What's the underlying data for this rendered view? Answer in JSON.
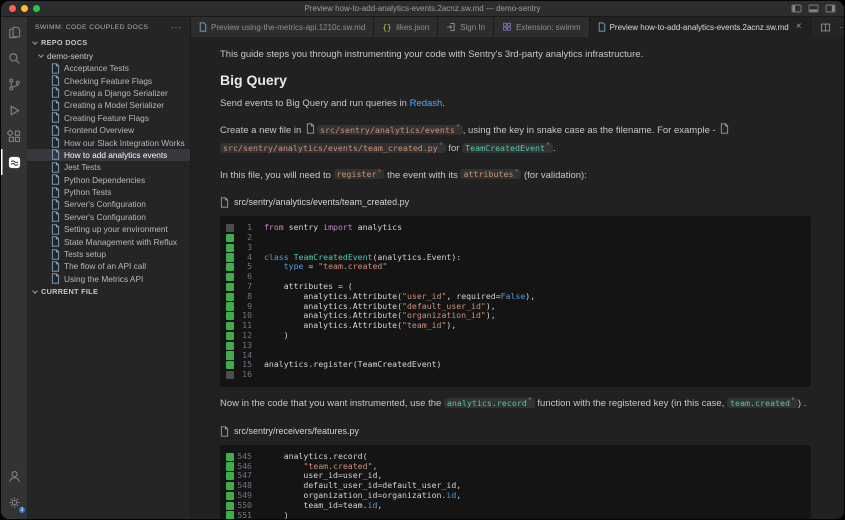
{
  "colors": {
    "accent_link": "#4daafc",
    "token_teal": "#4ec9b0",
    "token_tan": "#ce9178",
    "marker_green": "#3fae4a",
    "selection_bg": "#37373d",
    "badge_blue": "#2f7fd6"
  },
  "window": {
    "title": "Preview how-to-add-analytics-events.2acnz.sw.md — demo-sentry"
  },
  "titlebar": {
    "layout_icons": [
      "layout-sidebar-left-icon",
      "layout-panel-icon",
      "layout-sidebar-right-icon"
    ]
  },
  "activity_bar": {
    "top": [
      {
        "name": "explorer-icon",
        "active": false
      },
      {
        "name": "search-icon",
        "active": false
      },
      {
        "name": "source-control-icon",
        "active": false
      },
      {
        "name": "run-debug-icon",
        "active": false
      },
      {
        "name": "extensions-icon",
        "active": false
      },
      {
        "name": "swimm-icon",
        "active": true
      }
    ],
    "bottom": [
      {
        "name": "account-icon",
        "active": false
      },
      {
        "name": "settings-gear-icon",
        "active": false,
        "badge": "1"
      }
    ]
  },
  "sidebar": {
    "header": "SWIMM: CODE COUPLED DOCS",
    "header_more": "···",
    "sections": [
      {
        "label": "REPO DOCS"
      },
      {
        "label": "demo-sentry"
      }
    ],
    "items": [
      "Acceptance Tests",
      "Checking Feature Flags",
      "Creating a Django Serializer",
      "Creating a Model Serializer",
      "Creating Feature Flags",
      "Frontend Overview",
      "How our Slack Integration Works",
      "How to add analytics events",
      "Jest Tests",
      "Python Dependencies",
      "Python Tests",
      "Server's Configuration",
      "Server's Configuration",
      "Setting up your environment",
      "State Management with Reflux",
      "Tests setup",
      "The flow of an API call",
      "Using the Metrics API"
    ],
    "selected_index": 7,
    "footer_section": "CURRENT FILE"
  },
  "tabs": {
    "close_glyph": "×",
    "items": [
      {
        "label": "Preview using-the-metrics-api.1210c.sw.md",
        "icon": "preview-icon",
        "active": false
      },
      {
        "label": "likes.json",
        "icon": "json-icon",
        "active": false
      },
      {
        "label": "Sign In",
        "icon": "sign-in-icon",
        "active": false
      },
      {
        "label": "Extension: swimm",
        "icon": "extension-icon",
        "active": false
      },
      {
        "label": "Preview how-to-add-analytics-events.2acnz.sw.md",
        "icon": "preview-icon",
        "active": true
      }
    ],
    "actions": [
      {
        "name": "split-editor-icon",
        "glyph": ""
      },
      {
        "name": "more-actions-icon",
        "glyph": "···"
      }
    ]
  },
  "content": {
    "blocks": [
      {
        "type": "p",
        "segs": [
          {
            "t": "This guide steps you through instrumenting your code with Sentry's 3rd-party analytics infrastructure."
          }
        ]
      },
      {
        "type": "h2",
        "text": "Big Query"
      },
      {
        "type": "p",
        "segs": [
          {
            "t": "Send events to Big Query and run queries in "
          },
          {
            "t": "Redash",
            "k": "link"
          },
          {
            "t": "."
          }
        ]
      },
      {
        "type": "p",
        "segs": [
          {
            "t": "Create a new file in "
          },
          {
            "k": "fileicon"
          },
          {
            "t": "src/sentry/analytics/events",
            "k": "token",
            "c": "tan"
          },
          {
            "t": ", using the key in snake case as the filename. For example - "
          },
          {
            "k": "fileicon"
          },
          {
            "t": "src/sentry/analytics/events/team_created.py",
            "k": "token",
            "c": "tan"
          },
          {
            "t": " for "
          },
          {
            "t": "TeamCreatedEvent",
            "k": "token",
            "c": "teal"
          },
          {
            "t": "."
          }
        ]
      },
      {
        "type": "p",
        "segs": [
          {
            "t": "In this file, you will need to "
          },
          {
            "t": "register",
            "k": "token",
            "c": "tan"
          },
          {
            "t": " the event with its "
          },
          {
            "t": "attributes",
            "k": "token",
            "c": "tan"
          },
          {
            "t": " (for validation):"
          }
        ]
      },
      {
        "type": "code",
        "idx": 0
      },
      {
        "type": "p",
        "segs": [
          {
            "t": "Now in the code that you want instrumented, use the "
          },
          {
            "t": "analytics.record",
            "k": "token",
            "c": "teal"
          },
          {
            "t": " function with the registered key (in this case, "
          },
          {
            "t": "team.created",
            "k": "token",
            "c": "teal"
          },
          {
            "t": ") ."
          }
        ]
      },
      {
        "type": "code",
        "idx": 1
      }
    ]
  },
  "code_blocks": [
    {
      "path": "src/sentry/analytics/events/team_created.py",
      "lines": [
        {
          "n": "1",
          "m": "gray",
          "toks": [
            {
              "c": "kw",
              "t": "from"
            },
            {
              "t": " sentry "
            },
            {
              "c": "kw",
              "t": "import"
            },
            {
              "t": " analytics"
            }
          ]
        },
        {
          "n": "2",
          "m": "green",
          "toks": []
        },
        {
          "n": "3",
          "m": "green",
          "toks": []
        },
        {
          "n": "4",
          "m": "green",
          "toks": [
            {
              "c": "kwb",
              "t": "class"
            },
            {
              "t": " "
            },
            {
              "c": "cls",
              "t": "TeamCreatedEvent"
            },
            {
              "t": "(analytics.Event):"
            }
          ]
        },
        {
          "n": "5",
          "m": "green",
          "toks": [
            {
              "t": "    "
            },
            {
              "c": "kwb",
              "t": "type"
            },
            {
              "t": " = "
            },
            {
              "c": "str",
              "t": "\"team.created\""
            }
          ]
        },
        {
          "n": "6",
          "m": "green",
          "toks": []
        },
        {
          "n": "7",
          "m": "green",
          "toks": [
            {
              "t": "    attributes = ("
            }
          ]
        },
        {
          "n": "8",
          "m": "green",
          "toks": [
            {
              "t": "        analytics.Attribute("
            },
            {
              "c": "str",
              "t": "\"user_id\""
            },
            {
              "t": ", required="
            },
            {
              "c": "kwb",
              "t": "False"
            },
            {
              "t": "),"
            }
          ]
        },
        {
          "n": "9",
          "m": "green",
          "toks": [
            {
              "t": "        analytics.Attribute("
            },
            {
              "c": "str",
              "t": "\"default_user_id\""
            },
            {
              "t": "),"
            }
          ]
        },
        {
          "n": "10",
          "m": "green",
          "toks": [
            {
              "t": "        analytics.Attribute("
            },
            {
              "c": "str",
              "t": "\"organization_id\""
            },
            {
              "t": "),"
            }
          ]
        },
        {
          "n": "11",
          "m": "green",
          "toks": [
            {
              "t": "        analytics.Attribute("
            },
            {
              "c": "str",
              "t": "\"team_id\""
            },
            {
              "t": "),"
            }
          ]
        },
        {
          "n": "12",
          "m": "green",
          "toks": [
            {
              "t": "    )"
            }
          ]
        },
        {
          "n": "13",
          "m": "green",
          "toks": []
        },
        {
          "n": "14",
          "m": "green",
          "toks": []
        },
        {
          "n": "15",
          "m": "green",
          "toks": [
            {
              "t": "analytics.register(TeamCreatedEvent)"
            }
          ]
        },
        {
          "n": "16",
          "m": "gray",
          "toks": []
        }
      ]
    },
    {
      "path": "src/sentry/receivers/features.py",
      "lines": [
        {
          "n": "545",
          "m": "green",
          "toks": [
            {
              "t": "    analytics.record("
            }
          ]
        },
        {
          "n": "546",
          "m": "green",
          "toks": [
            {
              "t": "        "
            },
            {
              "c": "str",
              "t": "\"team.created\""
            },
            {
              "t": ","
            }
          ]
        },
        {
          "n": "547",
          "m": "green",
          "toks": [
            {
              "t": "        user_id=user_id,"
            }
          ]
        },
        {
          "n": "548",
          "m": "green",
          "toks": [
            {
              "t": "        default_user_id=default_user_id,"
            }
          ]
        },
        {
          "n": "549",
          "m": "green",
          "toks": [
            {
              "t": "        organization_id=organization."
            },
            {
              "c": "kwb",
              "t": "id"
            },
            {
              "t": ","
            }
          ]
        },
        {
          "n": "550",
          "m": "green",
          "toks": [
            {
              "t": "        team_id=team."
            },
            {
              "c": "kwb",
              "t": "id"
            },
            {
              "t": ","
            }
          ]
        },
        {
          "n": "551",
          "m": "green",
          "toks": [
            {
              "t": "    )"
            }
          ]
        }
      ]
    }
  ]
}
